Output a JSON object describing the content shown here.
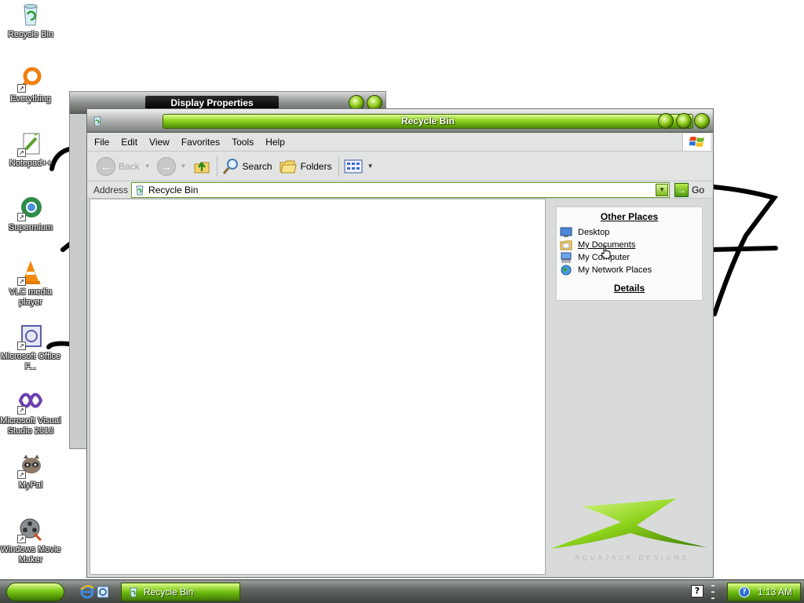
{
  "desktop": {
    "icons": [
      {
        "label": "Recycle Bin",
        "icon": "recycle-bin-icon"
      },
      {
        "label": "Everything",
        "icon": "everything-search-icon"
      },
      {
        "label": "Notepad++",
        "icon": "notepad-plus-plus-icon"
      },
      {
        "label": "Supermium",
        "icon": "browser-icon"
      },
      {
        "label": "VLC media player",
        "icon": "vlc-cone-icon"
      },
      {
        "label": "Microsoft Office F...",
        "icon": "office-frontpage-icon"
      },
      {
        "label": "Microsoft Visual Studio 2010",
        "icon": "visual-studio-icon"
      },
      {
        "label": "MyPal",
        "icon": "mypal-raccoon-icon"
      },
      {
        "label": "Windows Movie Maker",
        "icon": "movie-maker-icon"
      }
    ]
  },
  "background_window": {
    "title": "Display Properties"
  },
  "window": {
    "title": "Recycle Bin",
    "menu": [
      "File",
      "Edit",
      "View",
      "Favorites",
      "Tools",
      "Help"
    ],
    "toolbar": {
      "back": "Back",
      "search": "Search",
      "folders": "Folders"
    },
    "address": {
      "label": "Address",
      "value": "Recycle Bin",
      "go": "Go"
    },
    "taskpane": {
      "other_places_title": "Other Places",
      "links": [
        "Desktop",
        "My Documents",
        "My Computer",
        "My Network Places"
      ],
      "details_title": "Details",
      "brand_text": "AQUAJACK DESIGNS"
    }
  },
  "taskbar": {
    "task_label": "Recycle Bin",
    "help_glyph": "?",
    "clock": "1:13 AM"
  },
  "colors": {
    "accent_green": "#8dd41c",
    "chrome_gray": "#d7d9d8",
    "link_blue": "#000000"
  }
}
